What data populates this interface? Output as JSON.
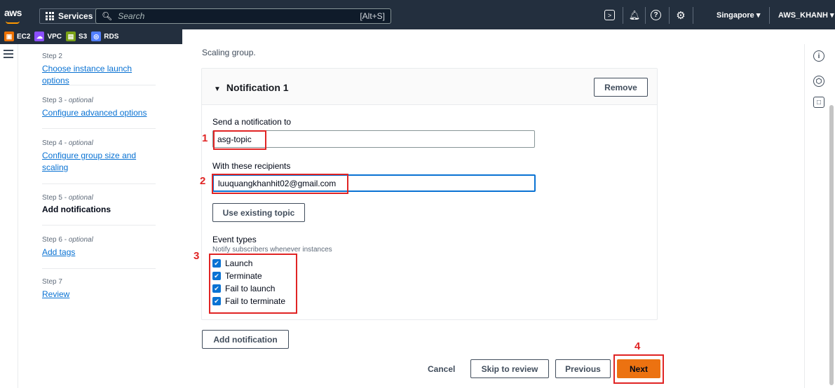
{
  "header": {
    "logo": "aws",
    "services_label": "Services",
    "search_placeholder": "Search",
    "search_shortcut": "[Alt+S]",
    "region": "Singapore ▾",
    "account": "AWS_KHANH ▾"
  },
  "favorites": [
    {
      "label": "EC2",
      "color": "#ed7100"
    },
    {
      "label": "VPC",
      "color": "#8c4fff"
    },
    {
      "label": "S3",
      "color": "#7aa116"
    },
    {
      "label": "RDS",
      "color": "#527fff"
    }
  ],
  "nav": {
    "step2": {
      "label": "Step 2",
      "link": "Choose instance launch options"
    },
    "step3": {
      "label": "Step 3",
      "optional": "optional",
      "link": "Configure advanced options"
    },
    "step4": {
      "label": "Step 4",
      "optional": "optional",
      "link1": "Configure group size and",
      "link2": "scaling"
    },
    "step5": {
      "label": "Step 5",
      "optional": "optional",
      "current": "Add notifications"
    },
    "step6": {
      "label": "Step 6",
      "optional": "optional",
      "link": "Add tags"
    },
    "step7": {
      "label": "Step 7",
      "link": "Review"
    }
  },
  "main": {
    "top_text": "Scaling group.",
    "notification": {
      "title": "Notification 1",
      "remove_label": "Remove",
      "send_to_label": "Send a notification to",
      "send_to_value": "asg-topic",
      "recipients_label": "With these recipients",
      "recipients_value": "luuquangkhanhit02@gmail.com",
      "use_existing_label": "Use existing topic",
      "event_types_label": "Event types",
      "event_types_desc": "Notify subscribers whenever instances",
      "events": [
        "Launch",
        "Terminate",
        "Fail to launch",
        "Fail to terminate"
      ]
    },
    "add_notification_label": "Add notification"
  },
  "footer": {
    "cancel": "Cancel",
    "skip": "Skip to review",
    "previous": "Previous",
    "next": "Next"
  },
  "annotations": [
    "1",
    "2",
    "3",
    "4"
  ],
  "colors": {
    "accent": "#0972d3",
    "primary_button": "#ec7211",
    "highlight": "#e02424",
    "header_bg": "#232f3e"
  }
}
